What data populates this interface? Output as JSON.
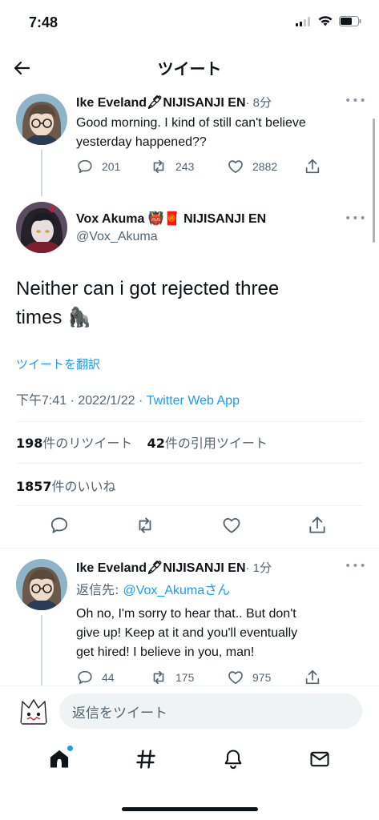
{
  "status": {
    "time": "7:48"
  },
  "header": {
    "title": "ツイート"
  },
  "tweet1": {
    "name": "Ike Eveland🖋NIJISANJI EN",
    "time": "· 8分",
    "text_line1": "Good morning. I kind of still can't believe",
    "text_line2": "yesterday happened??",
    "replies": "201",
    "retweets": "243",
    "likes": "2882"
  },
  "main": {
    "name": "Vox Akuma 👹🧧 NIJISANJI EN",
    "handle": "@Vox_Akuma",
    "text_line1": "Neither can i got rejected three",
    "text_line2": "times 🦍",
    "translate": "ツイートを翻訳",
    "meta_time": "下午7:41 · 2022/1/22 · ",
    "meta_source": "Twitter Web App",
    "retweet_count": "198",
    "retweet_label": "件のリツイート",
    "quote_count": "42",
    "quote_label": "件の引用ツイート",
    "like_count": "1857",
    "like_label": "件のいいね"
  },
  "reply": {
    "name": "Ike Eveland🖋NIJISANJI EN",
    "time": "· 1分",
    "reply_to_prefix": "返信先: ",
    "reply_to_handle": "@Vox_Akumaさん",
    "text_line1": "Oh no, I'm sorry to hear that.. But don't",
    "text_line2": "give up! Keep at it and you'll eventually",
    "text_line3": "get hired! I believe in you, man!",
    "replies": "44",
    "retweets": "175",
    "likes": "975"
  },
  "compose": {
    "placeholder": "返信をツイート"
  },
  "colors": {
    "accent": "#1d9bf0",
    "text": "#0f1419",
    "secondary": "#536471",
    "border": "#eff3f4"
  },
  "icons": [
    "back-arrow-icon",
    "reply-icon",
    "retweet-icon",
    "like-icon",
    "share-icon",
    "home-icon",
    "explore-hashtag-icon",
    "notifications-bell-icon",
    "messages-envelope-icon"
  ]
}
